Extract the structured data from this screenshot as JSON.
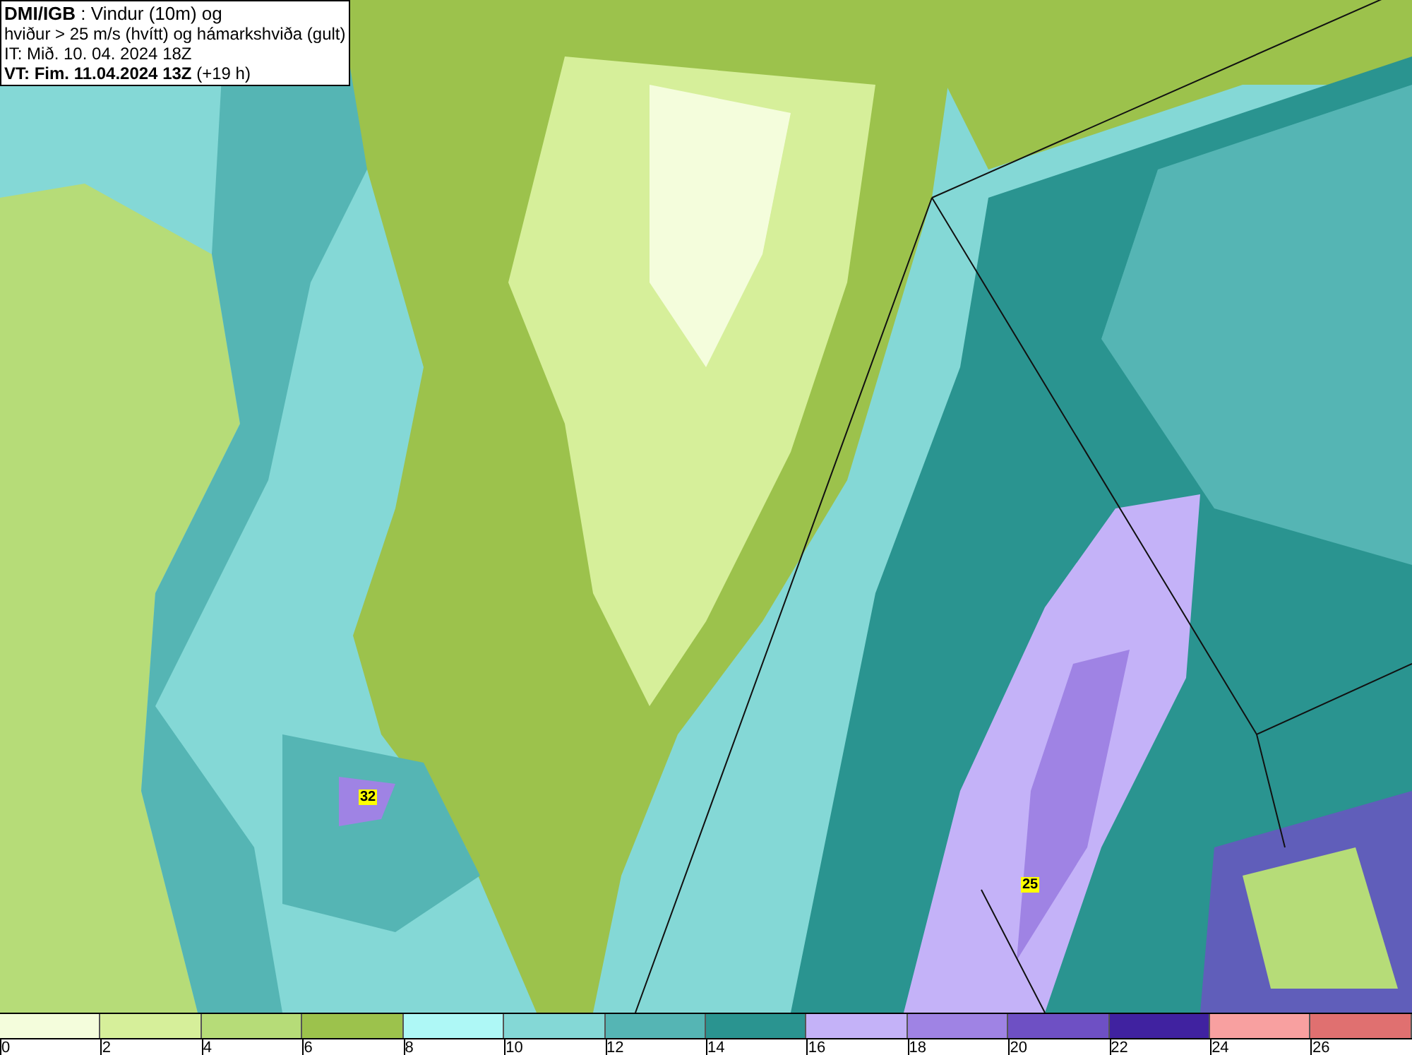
{
  "header": {
    "lines": [
      "**DMI/IGB** : Vindur (10m) og",
      "hviður > 25 m/s (hvítt) og hámarkshviða (gult)",
      "IT: Mið. 10. 04. 2024 18Z",
      "**VT: Fim. 11.04.2024 13Z** (+19 h)"
    ]
  },
  "map": {
    "peak_labels": [
      {
        "text": "32"
      },
      {
        "text": "25"
      }
    ]
  },
  "legend": {
    "bins": [
      {
        "color": "#f4fddc"
      },
      {
        "color": "#d6ef9a"
      },
      {
        "color": "#b6dc78"
      },
      {
        "color": "#9cc24c"
      },
      {
        "color": "#aef8f6"
      },
      {
        "color": "#84d8d6"
      },
      {
        "color": "#55b5b4"
      },
      {
        "color": "#2a9490"
      },
      {
        "color": "#c4b2f8"
      },
      {
        "color": "#9f83e4"
      },
      {
        "color": "#6e50c4"
      },
      {
        "color": "#4022a0"
      },
      {
        "color": "#f8a0a0"
      },
      {
        "color": "#e07070"
      }
    ],
    "ticks": [
      "0",
      "2",
      "4",
      "6",
      "8",
      "10",
      "12",
      "14",
      "16",
      "18",
      "20",
      "22",
      "24",
      "26"
    ]
  }
}
